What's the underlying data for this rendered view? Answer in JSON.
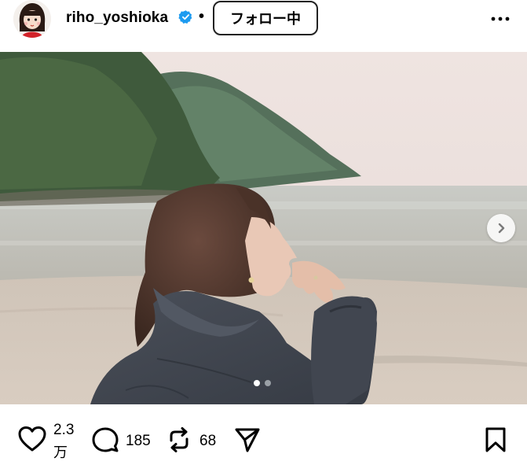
{
  "header": {
    "username": "riho_yoshioka",
    "separator": "•",
    "follow_label": "フォロー中"
  },
  "post": {
    "carousel": {
      "current_index": 1,
      "total": 2
    }
  },
  "actions": {
    "likes_count_line1": "2.3",
    "likes_count_line2": "万",
    "comments_count": "185",
    "reposts_count": "68"
  },
  "colors": {
    "verified_badge": "#1d9bf0",
    "active_dot": "#ffffff",
    "inactive_dot": "#9aa0a6"
  },
  "icons": [
    "verified-badge-icon",
    "more-options-icon",
    "chevron-right-icon",
    "heart-icon",
    "comment-icon",
    "repost-icon",
    "share-icon",
    "bookmark-icon"
  ]
}
